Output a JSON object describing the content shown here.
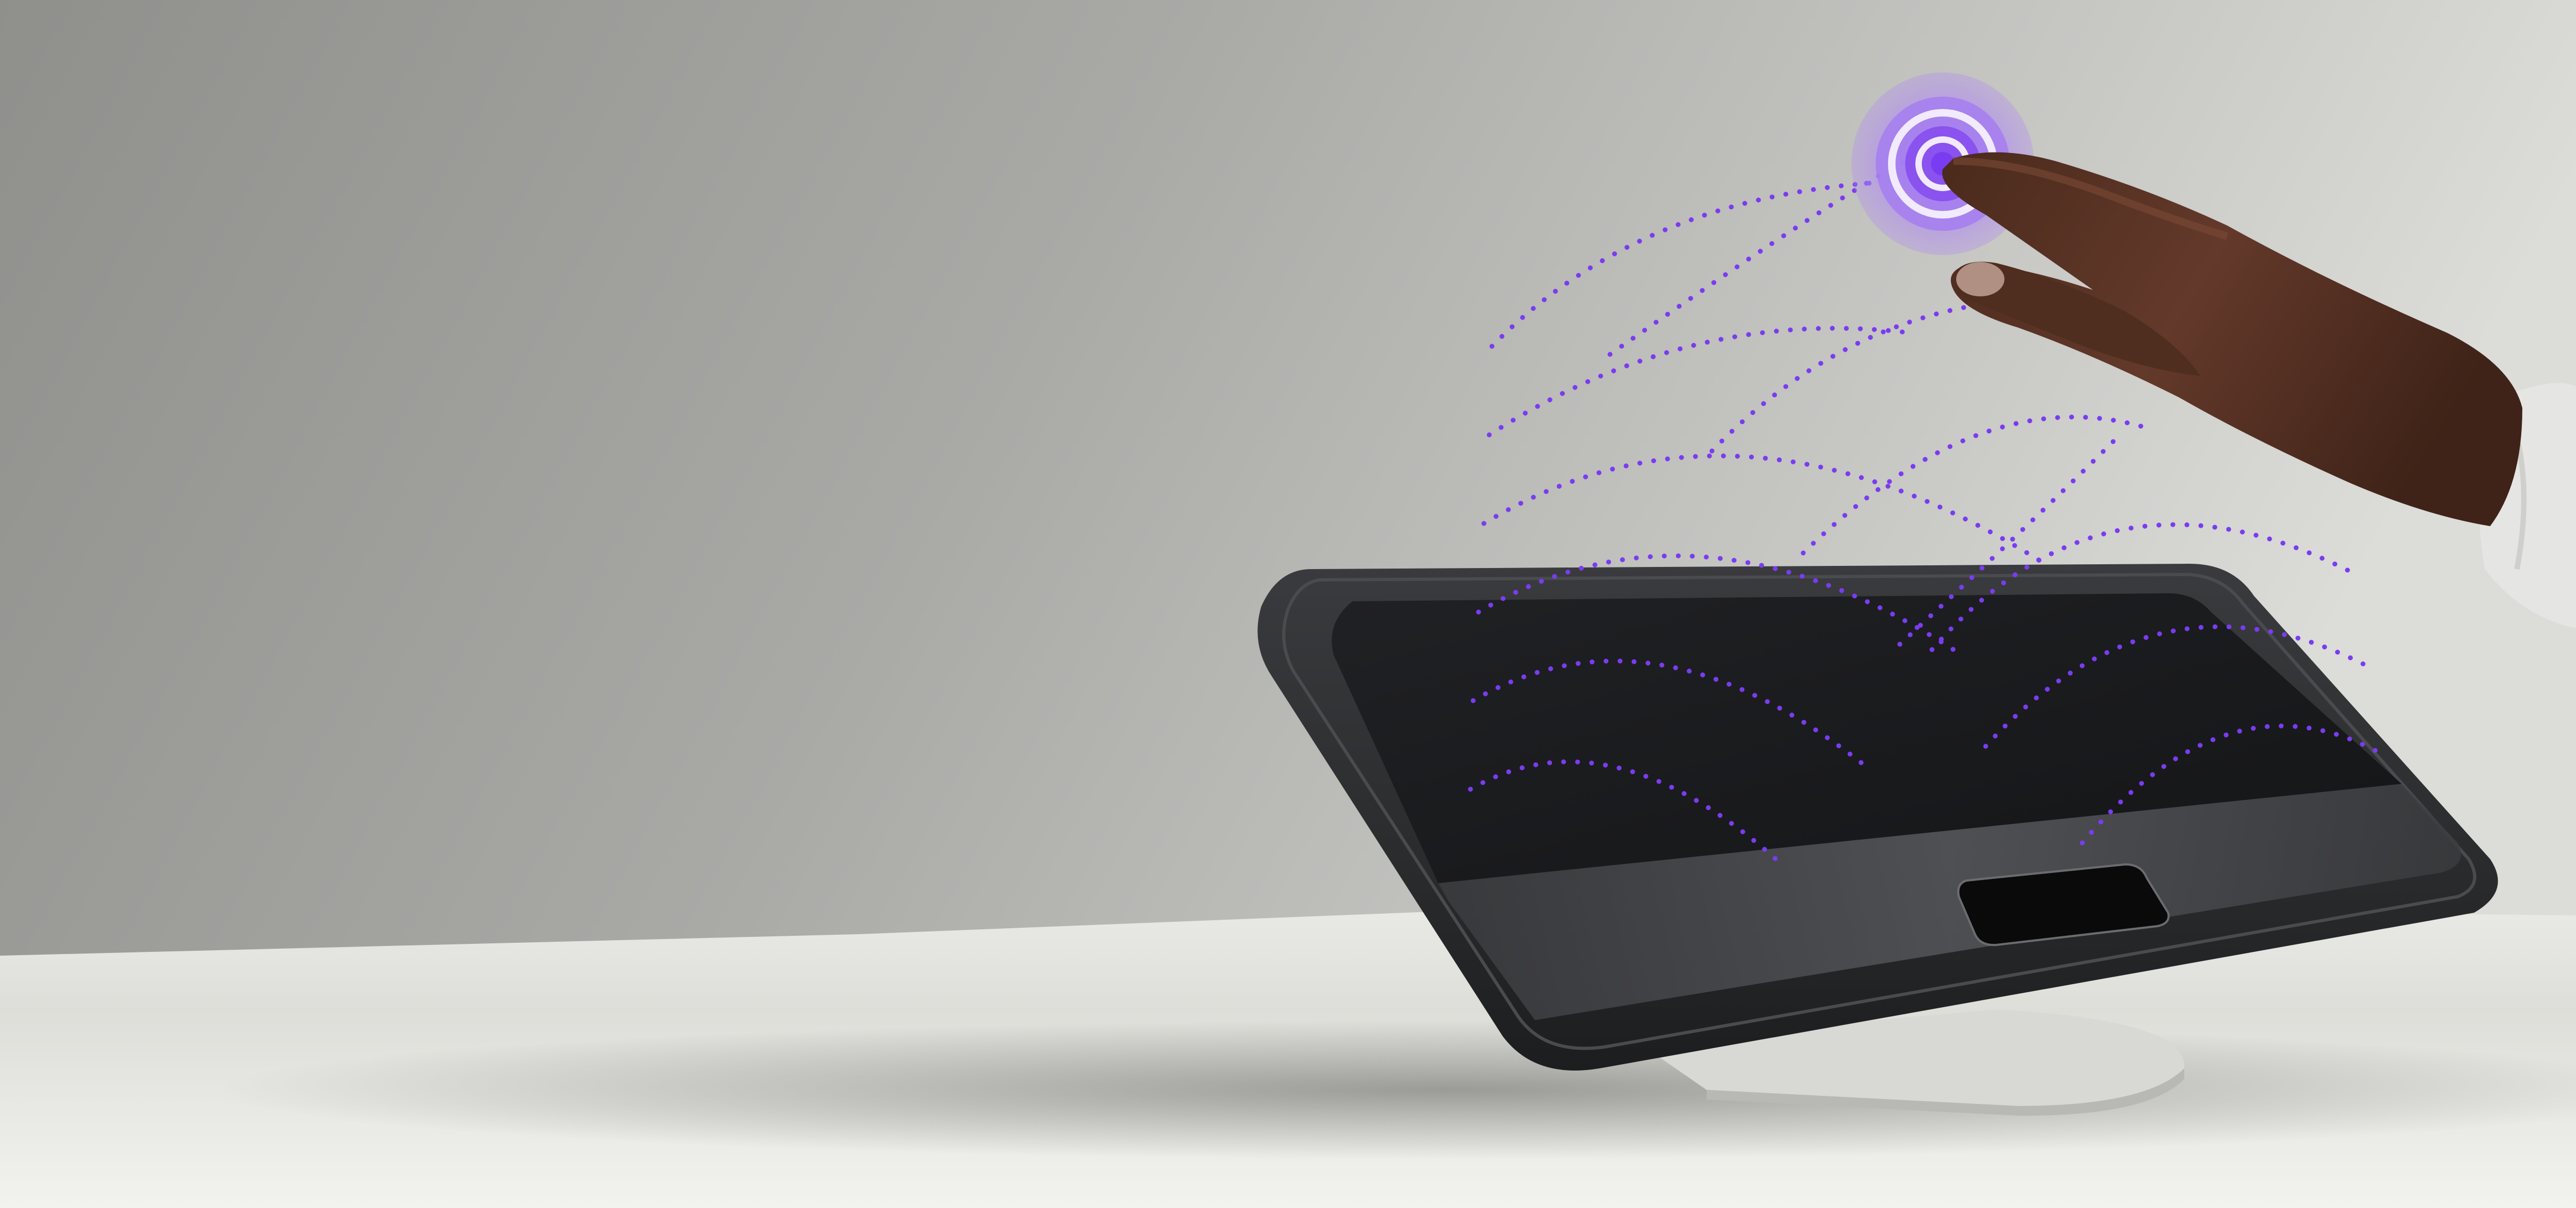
{
  "scene": {
    "subject": "",
    "colors": {
      "wall_light": "#dcdcd9",
      "wall_dark": "#8f8f8c",
      "table_top": "#e9e9e6",
      "device_body": "#2b2c2e",
      "device_screen": "#1a1b1d",
      "signal_purple": "#7a3cf0",
      "ring_light": "#c9b2f3",
      "skin": "#5a3524",
      "sleeve": "#e5e5e3"
    },
    "icons": [
      "touch-ripple-icon",
      "signal-wave-icon"
    ]
  }
}
